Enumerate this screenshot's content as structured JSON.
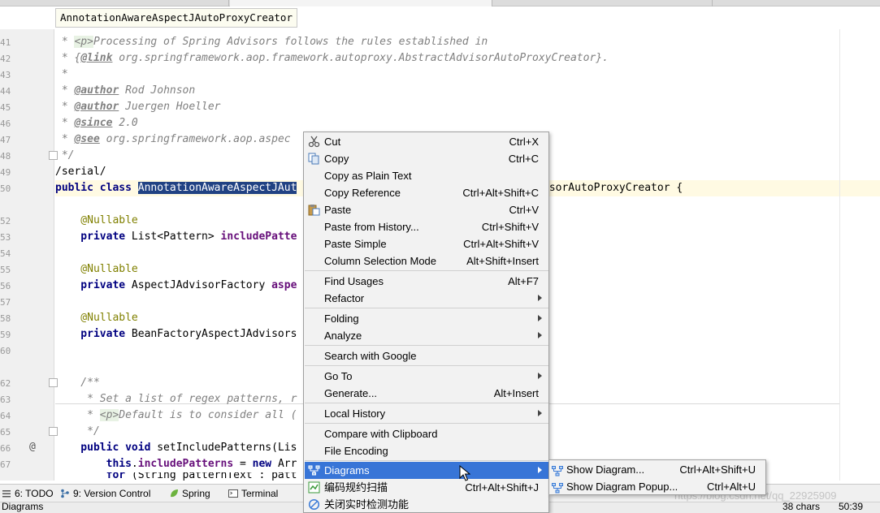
{
  "breadcrumb": "AnnotationAwareAspectJAutoProxyCreator",
  "gutter": {
    "line_numbers": [
      "41",
      "42",
      "43",
      "44",
      "45",
      "46",
      "47",
      "48",
      "49",
      "50",
      "51",
      "52",
      "53",
      "54",
      "55",
      "56",
      "57",
      "58",
      "59",
      "60",
      "61",
      "62",
      "63",
      "64",
      "65",
      "66",
      "67"
    ],
    "marker": "@"
  },
  "code": {
    "l41_a": " * ",
    "l41_tag": "<p>",
    "l41_b": "Processing of Spring Advisors follows the rules established in",
    "l42_a": " * {",
    "l42_tag": "@link",
    "l42_b": " org.springframework.aop.framework.autoproxy.AbstractAdvisorAutoProxyCreator}.",
    "l43": " *",
    "l44_a": " * ",
    "l44_tag": "@author",
    "l44_b": " Rod Johnson",
    "l45_a": " * ",
    "l45_tag": "@author",
    "l45_b": " Juergen Hoeller",
    "l46_a": " * ",
    "l46_tag": "@since",
    "l46_b": " 2.0",
    "l47_a": " * ",
    "l47_tag": "@see",
    "l47_b": " org.springframework.aop.aspec",
    "l48": " */",
    "l49": "/serial/",
    "l50_kw": "public class ",
    "l50_sel": "AnnotationAwareAspectJAut",
    "l50_tail": "isorAutoProxyCreator {",
    "l52_ann": "    @Nullable",
    "l53_kw": "    private ",
    "l53_type": "List<Pattern> ",
    "l53_fld": "includePatte",
    "l55_ann": "    @Nullable",
    "l56_kw": "    private ",
    "l56_type": "AspectJAdvisorFactory ",
    "l56_fld": "aspe",
    "l58_ann": "    @Nullable",
    "l59_kw": "    private ",
    "l59_type": "BeanFactoryAspectJAdvisors",
    "l62": "    /**",
    "l63": "     * Set a list of regex patterns, r",
    "l64_a": "     * ",
    "l64_tag": "<p>",
    "l64_b": "Default is to consider all (",
    "l65": "     */",
    "l66_kw": "    public void ",
    "l66_b": "setIncludePatterns(Lis",
    "l67_kw": "        this",
    "l67_b": ".",
    "l67_fld": "includePatterns",
    "l67_c": " = ",
    "l67_kw2": "new ",
    "l67_d": "Arr",
    "l68_kw": "        for ",
    "l68_b": "(String patternText : patt"
  },
  "context_menu": {
    "items": [
      {
        "label": "Cut",
        "shortcut": "Ctrl+X",
        "icon": "scissors-icon"
      },
      {
        "label": "Copy",
        "shortcut": "Ctrl+C",
        "icon": "copy-icon"
      },
      {
        "label": "Copy as Plain Text",
        "shortcut": ""
      },
      {
        "label": "Copy Reference",
        "shortcut": "Ctrl+Alt+Shift+C"
      },
      {
        "label": "Paste",
        "shortcut": "Ctrl+V",
        "icon": "paste-icon"
      },
      {
        "label": "Paste from History...",
        "shortcut": "Ctrl+Shift+V"
      },
      {
        "label": "Paste Simple",
        "shortcut": "Ctrl+Alt+Shift+V"
      },
      {
        "label": "Column Selection Mode",
        "shortcut": "Alt+Shift+Insert"
      },
      {
        "label": "Find Usages",
        "shortcut": "Alt+F7"
      },
      {
        "label": "Refactor",
        "submenu": true
      },
      {
        "label": "Folding",
        "submenu": true
      },
      {
        "label": "Analyze",
        "submenu": true
      },
      {
        "label": "Search with Google",
        "shortcut": ""
      },
      {
        "label": "Go To",
        "submenu": true
      },
      {
        "label": "Generate...",
        "shortcut": "Alt+Insert"
      },
      {
        "label": "Local History",
        "submenu": true
      },
      {
        "label": "Compare with Clipboard",
        "shortcut": ""
      },
      {
        "label": "File Encoding",
        "shortcut": ""
      },
      {
        "label": "Diagrams",
        "submenu": true,
        "highlighted": true,
        "icon": "diagram-icon"
      },
      {
        "label": "编码规约扫描",
        "shortcut": "Ctrl+Alt+Shift+J",
        "icon": "scan-icon"
      },
      {
        "label": "关闭实时检测功能",
        "shortcut": "",
        "icon": "disable-icon"
      }
    ]
  },
  "submenu": {
    "items": [
      {
        "label": "Show Diagram...",
        "shortcut": "Ctrl+Alt+Shift+U",
        "icon": "diagram-icon"
      },
      {
        "label": "Show Diagram Popup...",
        "shortcut": "Ctrl+Alt+U",
        "icon": "diagram-icon"
      }
    ]
  },
  "tool_windows": [
    {
      "label": "6: TODO",
      "icon": "todo-icon"
    },
    {
      "label": "9: Version Control",
      "icon": "vcs-icon"
    },
    {
      "label": "Spring",
      "icon": "spring-icon"
    },
    {
      "label": "Terminal",
      "icon": "terminal-icon"
    }
  ],
  "status": {
    "left": "Diagrams",
    "chars": "38 chars",
    "position": "50:39"
  },
  "watermark": "https://blog.csdn.net/qq_22925909",
  "colors": {
    "menu_highlight": "#3875d7",
    "selection": "#214283",
    "caret_line": "#fffae3"
  }
}
